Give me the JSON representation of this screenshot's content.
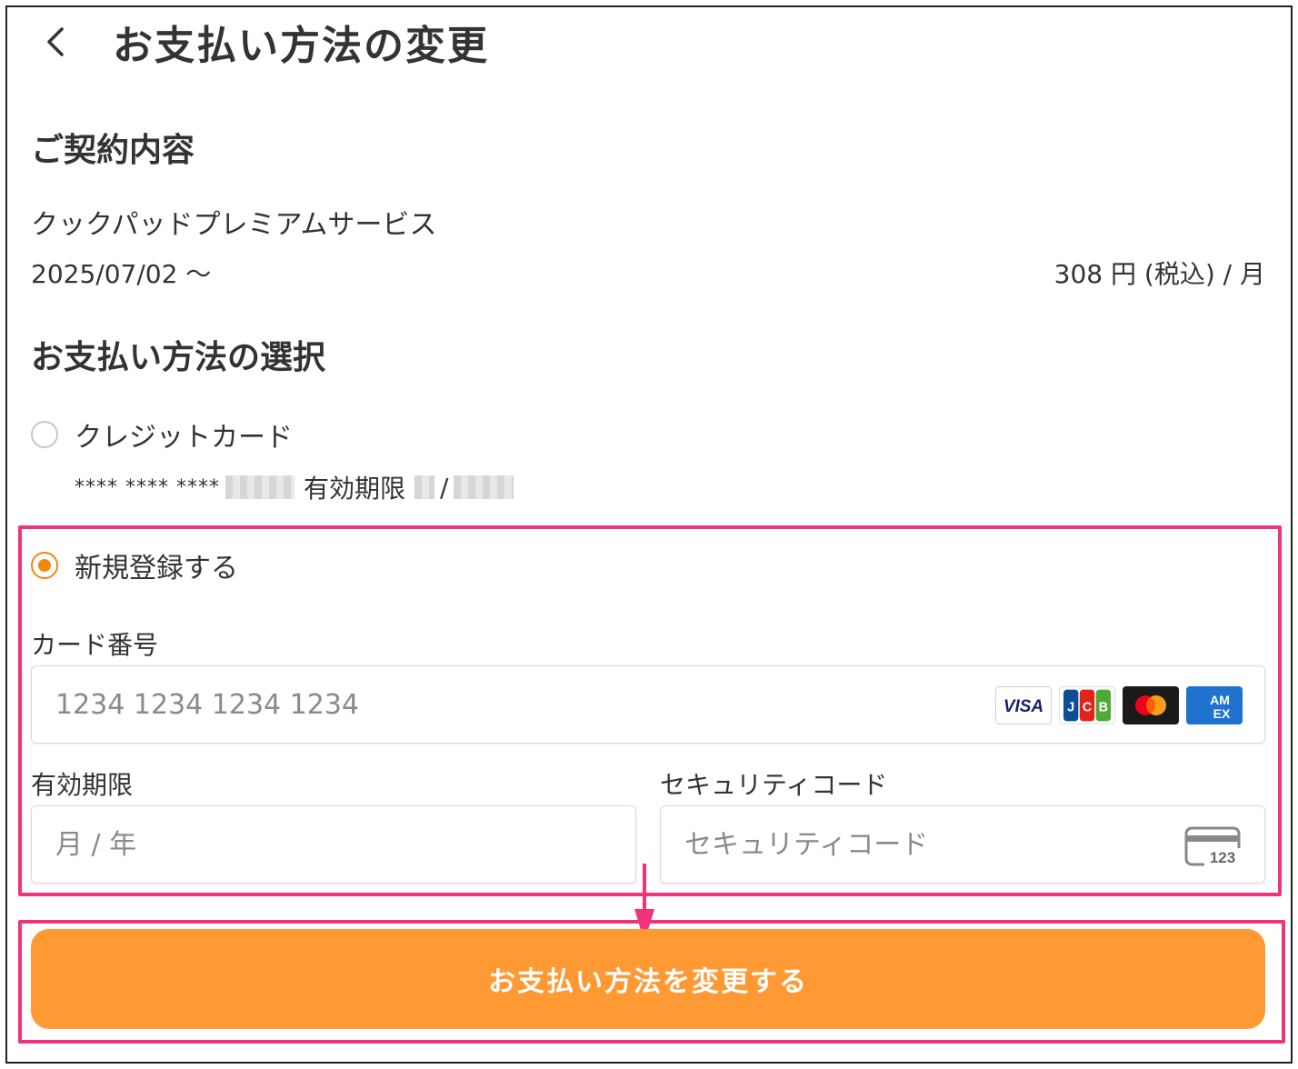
{
  "header": {
    "title": "お支払い方法の変更"
  },
  "contract": {
    "section_title": "ご契約内容",
    "service_name": "クックパッドプレミアムサービス",
    "start_date": "2025/07/02 〜",
    "price": "308 円 (税込) / 月"
  },
  "payment": {
    "section_title": "お支払い方法の選択",
    "options": [
      {
        "label": "クレジットカード",
        "selected": false
      },
      {
        "label": "新規登録する",
        "selected": true
      }
    ],
    "saved_card": {
      "masked_number": "**** **** ****",
      "expiry_label": "有効期限",
      "separator": "/"
    }
  },
  "form": {
    "card_number_label": "カード番号",
    "card_number_placeholder": "1234 1234 1234 1234",
    "expiry_label": "有効期限",
    "expiry_placeholder": "月 / 年",
    "cvc_label": "セキュリティコード",
    "cvc_placeholder": "セキュリティコード",
    "cvc_icon_text": "123",
    "brands": [
      "VISA",
      "JCB",
      "Mastercard",
      "AMEX"
    ]
  },
  "submit": {
    "label": "お支払い方法を変更する"
  },
  "colors": {
    "accent": "#ff9933",
    "radio_selected": "#f0870f",
    "highlight": "#f0337a"
  }
}
